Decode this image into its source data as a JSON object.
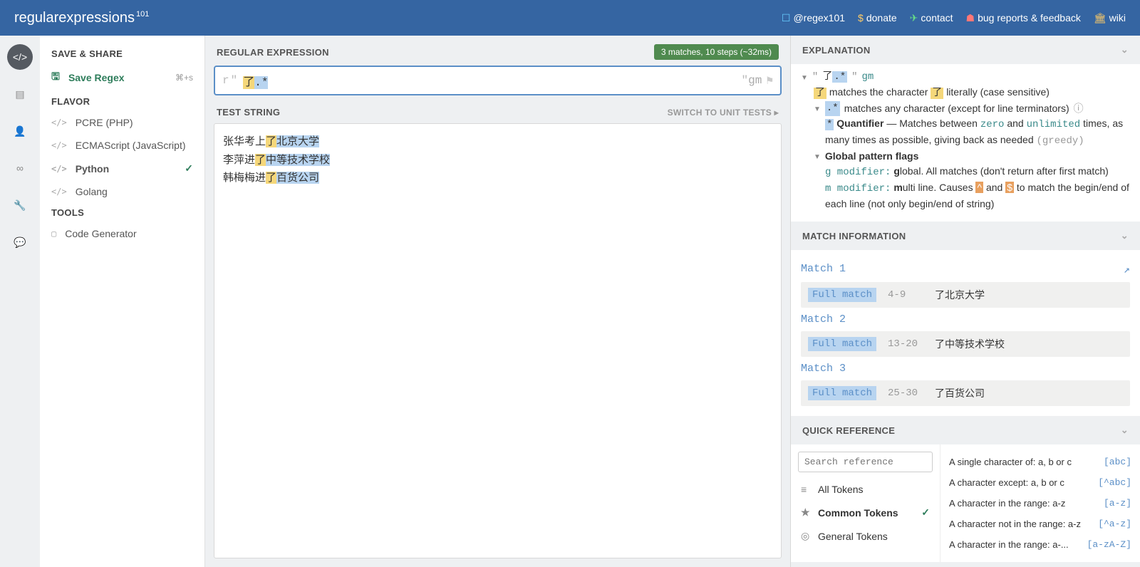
{
  "header": {
    "logo_bold": "regular",
    "logo_light": "expressions",
    "logo_sub": "101",
    "links": {
      "regex101": "@regex101",
      "donate": "donate",
      "contact": "contact",
      "bugs": "bug reports & feedback",
      "wiki": "wiki"
    }
  },
  "sidebar": {
    "save_share": "SAVE & SHARE",
    "save_regex": "Save Regex",
    "save_shortcut": "⌘+s",
    "flavor": "FLAVOR",
    "flavors": [
      {
        "label": "PCRE (PHP)"
      },
      {
        "label": "ECMAScript (JavaScript)"
      },
      {
        "label": "Python",
        "selected": true
      },
      {
        "label": "Golang"
      }
    ],
    "tools": "TOOLS",
    "code_gen": "Code Generator"
  },
  "center": {
    "regex_title": "REGULAR EXPRESSION",
    "match_badge": "3 matches, 10 steps (~32ms)",
    "prefix": "r\"",
    "pattern_literal": "了",
    "pattern_meta": ".*",
    "suffix": "\"",
    "flags": "gm",
    "test_title": "TEST STRING",
    "switch": "SWITCH TO UNIT TESTS",
    "test_lines": [
      {
        "pre": "张华考上",
        "char": "了",
        "post": "北京大学"
      },
      {
        "pre": "李萍进",
        "char": "了",
        "post": "中等技术学校"
      },
      {
        "pre": "韩梅梅进",
        "char": "了",
        "post": "百货公司"
      }
    ]
  },
  "explanation": {
    "title": "EXPLANATION",
    "raw_pattern": "了.*",
    "flags": "gm",
    "char_literal": "了",
    "char_text_pre": "matches the character",
    "char_text_post": "literally (case sensitive)",
    "dotstar": ".*",
    "dotstar_text": "matches any character (except for line terminators)",
    "star": "*",
    "quant_label": "Quantifier",
    "quant_text1": "— Matches between",
    "zero": "zero",
    "and": "and",
    "unlimited": "unlimited",
    "quant_text2": "times, as many times as possible, giving back as needed",
    "greedy": "(greedy)",
    "gpf": "Global pattern flags",
    "g_mod": "g modifier:",
    "g_bold": "g",
    "g_text": "lobal. All matches (don't return after first match)",
    "m_mod": "m modifier:",
    "m_bold": "m",
    "m_text_pre": "ulti line. Causes",
    "caret": "^",
    "dollar": "$",
    "m_text_post": "to match the begin/end of each line (not only begin/end of string)"
  },
  "matchinfo": {
    "title": "MATCH INFORMATION",
    "full_match_label": "Full match",
    "matches": [
      {
        "title": "Match 1",
        "range": "4-9",
        "value": "了北京大学"
      },
      {
        "title": "Match 2",
        "range": "13-20",
        "value": "了中等技术学校"
      },
      {
        "title": "Match 3",
        "range": "25-30",
        "value": "了百货公司"
      }
    ]
  },
  "quickref": {
    "title": "QUICK REFERENCE",
    "search_placeholder": "Search reference",
    "cats": [
      {
        "icon": "≡",
        "label": "All Tokens"
      },
      {
        "icon": "★",
        "label": "Common Tokens",
        "selected": true
      },
      {
        "icon": "◎",
        "label": "General Tokens"
      }
    ],
    "items": [
      {
        "desc": "A single character of: a, b or c",
        "code": "[abc]"
      },
      {
        "desc": "A character except: a, b or c",
        "code": "[^abc]"
      },
      {
        "desc": "A character in the range: a-z",
        "code": "[a-z]"
      },
      {
        "desc": "A character not in the range: a-z",
        "code": "[^a-z]"
      },
      {
        "desc": "A character in the range: a-...",
        "code": "[a-zA-Z]"
      }
    ]
  }
}
